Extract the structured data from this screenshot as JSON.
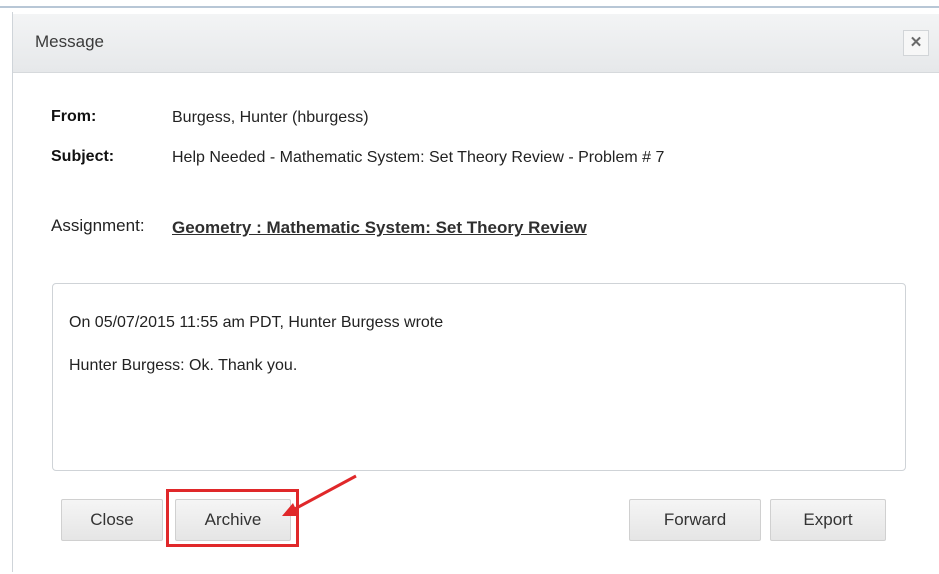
{
  "dialog": {
    "title": "Message",
    "close_glyph": "✕"
  },
  "fields": {
    "from_label": "From:",
    "from_value": "Burgess, Hunter (hburgess)",
    "subject_label": "Subject:",
    "subject_value": "Help Needed - Mathematic System: Set Theory Review - Problem # 7",
    "assignment_label": "Assignment:",
    "assignment_value": "Geometry : Mathematic System: Set Theory Review"
  },
  "message": {
    "header": "On 05/07/2015 11:55 am PDT, Hunter Burgess wrote",
    "body": "Hunter Burgess: Ok. Thank you."
  },
  "buttons": {
    "close": "Close",
    "archive": "Archive",
    "forward": "Forward",
    "export": "Export"
  },
  "annotation": {
    "color": "#e0282a",
    "shape": "red-rectangle-with-arrow"
  }
}
